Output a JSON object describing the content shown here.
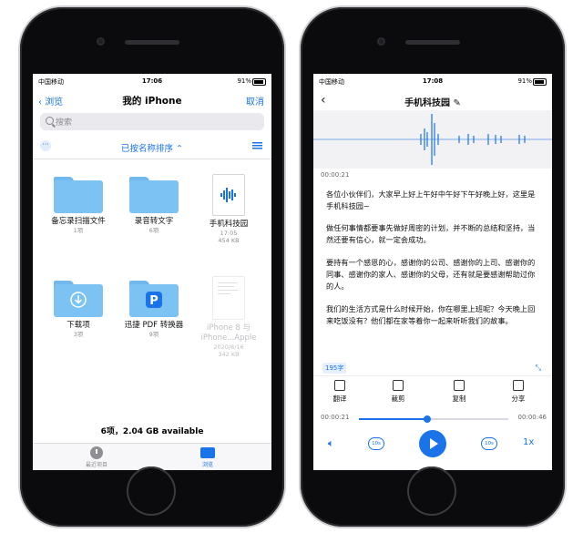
{
  "left_phone": {
    "status": {
      "carrier": "中国移动",
      "time": "17:06",
      "battery": "91%"
    },
    "nav": {
      "back_label": "浏览",
      "title": "我的 iPhone",
      "cancel_label": "取消"
    },
    "search": {
      "placeholder": "搜索"
    },
    "sort": {
      "label": "已按名称排序"
    },
    "items": [
      {
        "name": "备忘录扫描文件",
        "sub": "1项"
      },
      {
        "name": "录音转文字",
        "sub": "6项"
      },
      {
        "name": "手机科技园",
        "sub": "17:05",
        "sub2": "454 KB"
      },
      {
        "name": "下载项",
        "sub": "3项"
      },
      {
        "name": "迅捷 PDF 转换器",
        "sub": "9项"
      },
      {
        "name": "iPhone 8 与 iPhone...Apple",
        "sub": "2020/8/16",
        "sub2": "342 KB"
      }
    ],
    "footer": {
      "count": "6项，2.04 GB available"
    },
    "tabbar": {
      "recent_label": "最近项目",
      "browse_label": "浏览"
    }
  },
  "right_phone": {
    "status": {
      "carrier": "中国移动",
      "time": "17:08",
      "battery": "91%"
    },
    "title": "手机科技园",
    "current_time": "00:00:21",
    "paragraphs": [
      "各位小伙伴们，大家早上好上午好中午好下午好晚上好，这里是手机科技园~",
      "做任何事情都要事先做好周密的计划，并不断的总结和坚持，当然还要有信心，就一定会成功。",
      "要持有一个感恩的心，感谢你的公司、感谢你的上司、感谢你的同事、感谢你的家人、感谢你的父母，还有就是要感谢帮助过你的人。",
      "我们的生活方式是什么时候开始，你在哪里上班呢？今天晚上回来吃饭没有？他们都在家等着你一起来听听我们的故事。"
    ],
    "word_count": "195字",
    "actions": [
      {
        "label": "翻译"
      },
      {
        "label": "裁剪"
      },
      {
        "label": "复制"
      },
      {
        "label": "分享"
      }
    ],
    "player": {
      "elapsed": "00:00:21",
      "total": "00:00:46",
      "progress": 0.457,
      "skip_back": "10s",
      "skip_fwd": "10s",
      "speed": "1x"
    },
    "accent_color": "#1a73e8"
  }
}
